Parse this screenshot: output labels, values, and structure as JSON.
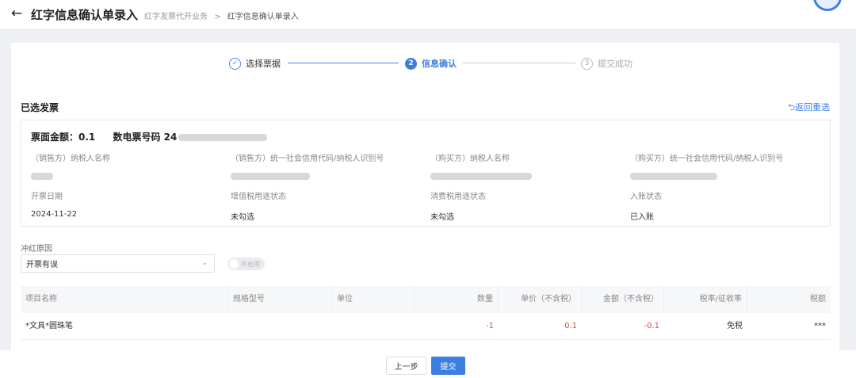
{
  "header": {
    "title": "红字信息确认单录入",
    "breadcrumb": [
      "红字发票代开业务",
      "红字信息确认单录入"
    ],
    "breadcrumb_sep": ">"
  },
  "steps": [
    {
      "num": "✓",
      "label": "选择票据"
    },
    {
      "num": "2",
      "label": "信息确认"
    },
    {
      "num": "3",
      "label": "提交成功"
    }
  ],
  "section": {
    "title": "已选发票",
    "reselect": "返回重选"
  },
  "invoice": {
    "amount_label": "票面金额：",
    "amount": "0.1",
    "number_label": "数电票号码",
    "number_visible": "24",
    "fields": [
      {
        "label": "（销售方）纳税人名称",
        "value": ""
      },
      {
        "label": "（销售方）统一社会信用代码/纳税人识别号",
        "value": ""
      },
      {
        "label": "（购买方）纳税人名称",
        "value": ""
      },
      {
        "label": "（购买方）统一社会信用代码/纳税人识别号",
        "value": ""
      },
      {
        "label": "开票日期",
        "value": "2024-11-22"
      },
      {
        "label": "增值税用途状态",
        "value": "未勾选"
      },
      {
        "label": "消费税用途状态",
        "value": "未勾选"
      },
      {
        "label": "入账状态",
        "value": "已入账"
      }
    ]
  },
  "reason": {
    "label": "冲红原因",
    "value": "开票有误",
    "toggle_label": "不启用"
  },
  "table": {
    "headers": [
      "项目名称",
      "规格型号",
      "单位",
      "数量",
      "单价（不含税）",
      "金额（不含税）",
      "税率/征收率",
      "税额"
    ],
    "rows": [
      [
        "*文具*圆珠笔",
        "",
        "",
        "-1",
        "0.1",
        "-0.1",
        "免税",
        "***"
      ]
    ]
  },
  "footer": {
    "prev": "上一步",
    "submit": "提交"
  },
  "colors": {
    "accent": "#3d7fe0",
    "negative": "#e0463d"
  }
}
